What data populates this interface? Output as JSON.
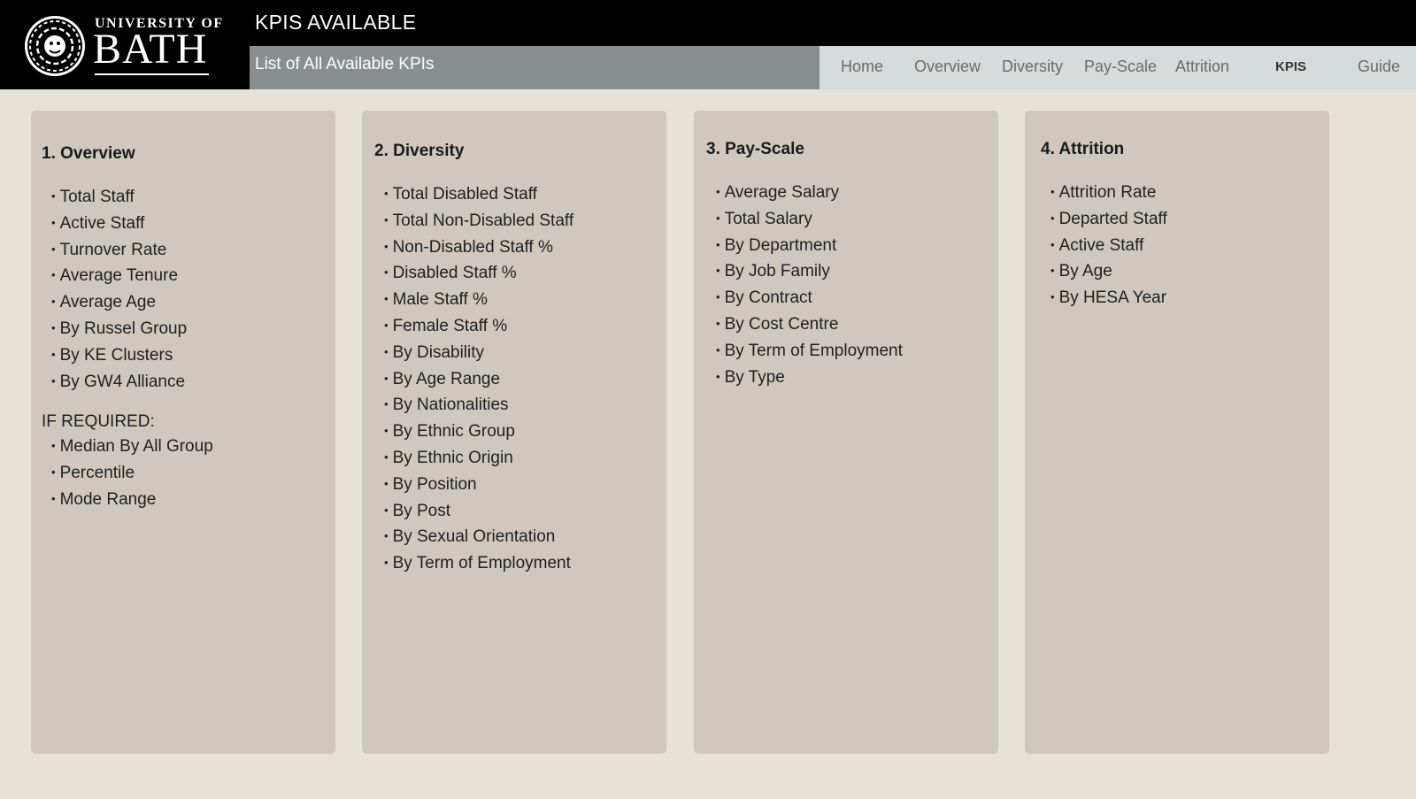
{
  "header": {
    "logo": {
      "line1": "UNIVERSITY OF",
      "line2": "BATH",
      "icon": "bath-crest-icon"
    },
    "title": "KPIS AVAILABLE",
    "subtitle": "List of All Available KPIs"
  },
  "nav": {
    "items": [
      {
        "label": "Home",
        "active": false
      },
      {
        "label": "Overview",
        "active": false
      },
      {
        "label": "Diversity",
        "active": false
      },
      {
        "label": "Pay-Scale",
        "active": false
      },
      {
        "label": "Attrition",
        "active": false
      },
      {
        "label": "KPIS",
        "active": true
      },
      {
        "label": "Guide",
        "active": false
      }
    ]
  },
  "cards": [
    {
      "title": "1. Overview",
      "items": [
        "Total Staff",
        "Active Staff",
        "Turnover Rate",
        "Average Tenure",
        "Average Age",
        "By Russel Group",
        "By KE Clusters",
        "By GW4 Alliance"
      ],
      "extra_heading": "IF REQUIRED:",
      "extra_items": [
        "Median By All Group",
        "Percentile",
        "Mode Range"
      ]
    },
    {
      "title": "2. Diversity",
      "items": [
        "Total Disabled Staff",
        "Total Non-Disabled Staff",
        "Non-Disabled Staff %",
        "Disabled Staff %",
        "Male Staff %",
        "Female Staff %",
        "By Disability",
        "By Age Range",
        "By Nationalities",
        "By Ethnic Group",
        "By Ethnic Origin",
        "By Position",
        "By Post",
        "By Sexual Orientation",
        "By Term of Employment"
      ]
    },
    {
      "title": "3. Pay-Scale",
      "items": [
        "Average Salary",
        "Total Salary",
        "By Department",
        "By Job Family",
        "By Contract",
        "By Cost Centre",
        "By Term of Employment",
        "By Type"
      ]
    },
    {
      "title": "4. Attrition",
      "items": [
        "Attrition Rate",
        "Departed Staff",
        "Active Staff",
        "By Age",
        "By HESA Year"
      ]
    }
  ],
  "colors": {
    "header_bg": "#000000",
    "subtitle_bg": "#898f8f",
    "nav_bg": "#d6dbdc",
    "page_bg": "#e6e2d9",
    "card_bg": "#d0c8be"
  }
}
